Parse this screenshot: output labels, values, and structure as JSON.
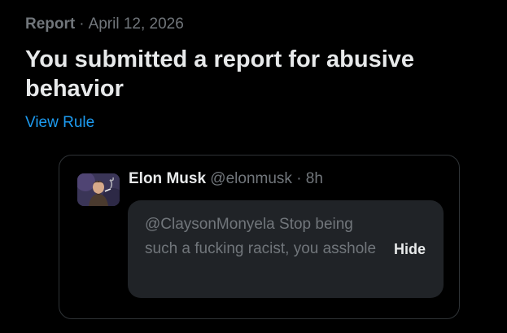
{
  "report": {
    "kind": "Report",
    "separator": "·",
    "date": "April 12, 2026",
    "title": "You submitted a report for abusive behavior",
    "view_rule_label": "View Rule"
  },
  "post": {
    "author_name": "Elon Musk",
    "author_handle": "@elonmusk",
    "separator": "·",
    "time": "8h",
    "avatar_icon": "user-avatar-icon",
    "text": "@ClaysonMonyela Stop being such a fucking racist, you asshole",
    "hide_label": "Hide"
  },
  "colors": {
    "background": "#000000",
    "text_primary": "#e7e9ea",
    "text_secondary": "#71767b",
    "link": "#1d9bf0",
    "card_border": "#2f3336",
    "hidden_box": "#202327"
  }
}
